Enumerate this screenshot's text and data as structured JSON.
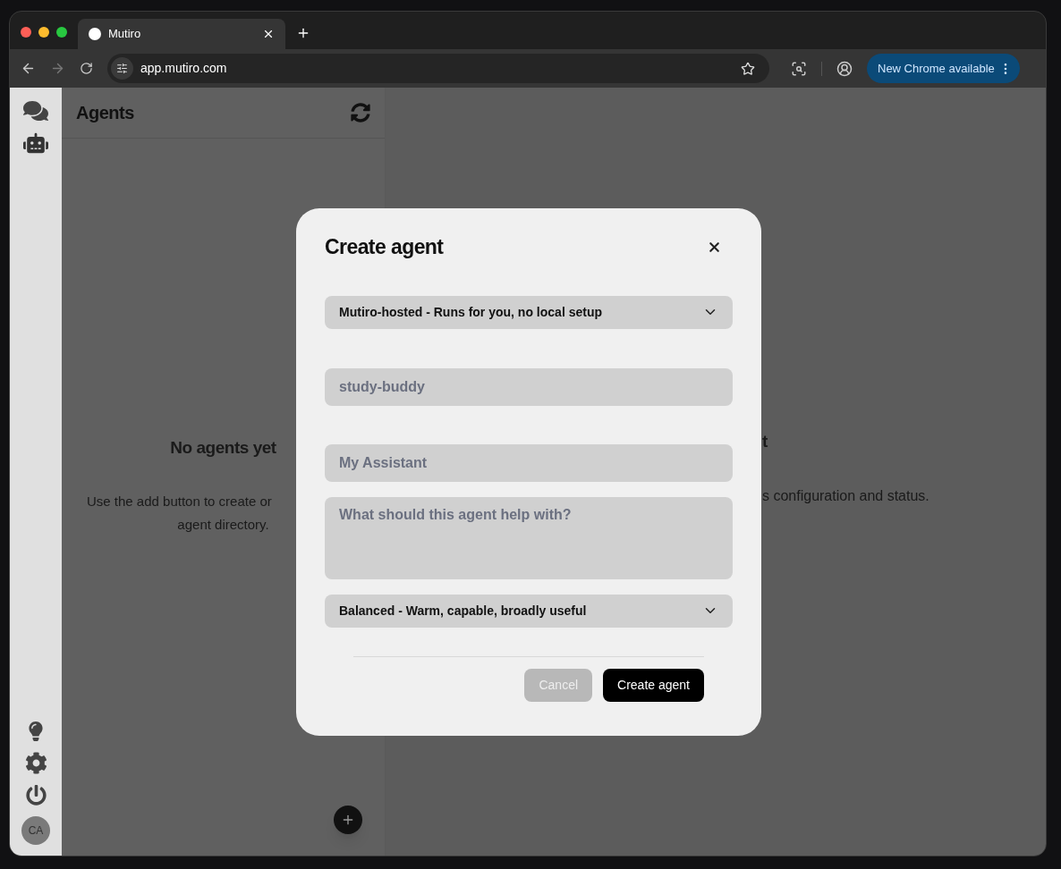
{
  "browser": {
    "tab": {
      "title": "Mutiro"
    },
    "address": "app.mutiro.com",
    "update_button": "New Chrome available"
  },
  "sidebar": {
    "avatar": "CA"
  },
  "agents_panel": {
    "title": "Agents",
    "empty_title": "No agents yet",
    "empty_text_lines": [
      "Use the add button to create or",
      "agent directory."
    ]
  },
  "detail_pane": {
    "text_fragments": [
      "t",
      "s configuration and status."
    ]
  },
  "dialog": {
    "title": "Create agent",
    "fields": [
      {
        "kind": "select",
        "value": "Mutiro-hosted - Runs for you, no local setup"
      },
      {
        "kind": "input",
        "placeholder": "study-buddy"
      },
      {
        "kind": "input",
        "placeholder": "My Assistant"
      },
      {
        "kind": "textarea",
        "placeholder": "What should this agent help with?"
      },
      {
        "kind": "select",
        "value": "Balanced - Warm, capable, broadly useful"
      }
    ],
    "buttons": [
      {
        "label": "Cancel",
        "disabled": true
      },
      {
        "label": "Create agent",
        "disabled": false
      }
    ]
  }
}
